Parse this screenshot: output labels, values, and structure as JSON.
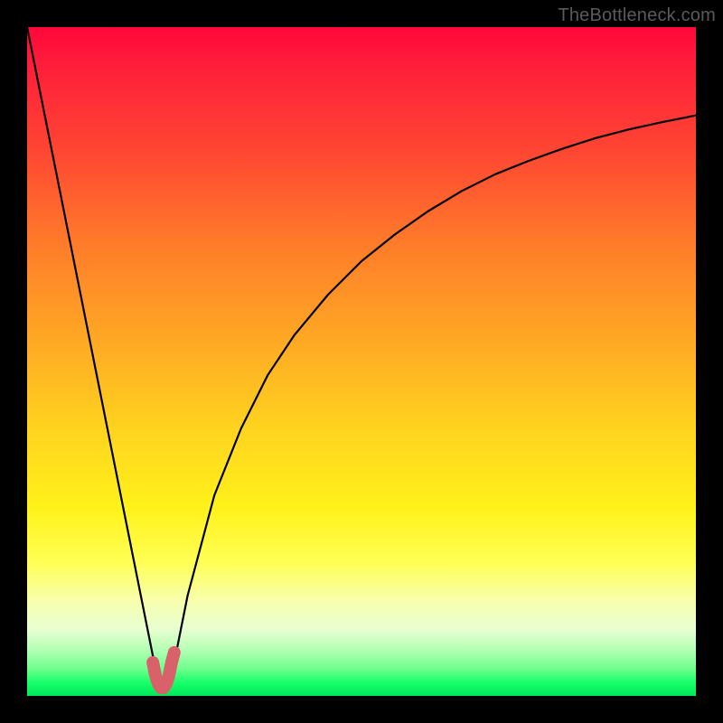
{
  "watermark": {
    "text": "TheBottleneck.com"
  },
  "chart_data": {
    "type": "line",
    "title": "",
    "xlabel": "",
    "ylabel": "",
    "xlim": [
      0,
      100
    ],
    "ylim": [
      0,
      100
    ],
    "grid": false,
    "legend": false,
    "series": [
      {
        "name": "bottleneck-curve",
        "color": "#000000",
        "x": [
          0,
          2,
          4,
          6,
          8,
          10,
          12,
          14,
          16,
          18,
          19,
          19.5,
          20,
          20.5,
          21,
          21.5,
          22,
          24,
          28,
          32,
          36,
          40,
          45,
          50,
          55,
          60,
          65,
          70,
          75,
          80,
          85,
          90,
          95,
          100
        ],
        "y": [
          100,
          90,
          80,
          70,
          60,
          50,
          40,
          30,
          20,
          10,
          5,
          2.5,
          1.5,
          1.2,
          1.5,
          2.5,
          5,
          15,
          30,
          40,
          48,
          54,
          60,
          65,
          69,
          72.5,
          75.5,
          78,
          80,
          81.8,
          83.4,
          84.7,
          85.8,
          86.8
        ]
      },
      {
        "name": "optimal-marker",
        "color": "#d9626a",
        "x": [
          18.8,
          19.2,
          19.6,
          20,
          20.4,
          20.8,
          21.2,
          21.6,
          22
        ],
        "y": [
          5,
          3,
          1.8,
          1.2,
          1.2,
          1.8,
          3,
          5,
          6.5
        ]
      }
    ],
    "annotations": []
  }
}
